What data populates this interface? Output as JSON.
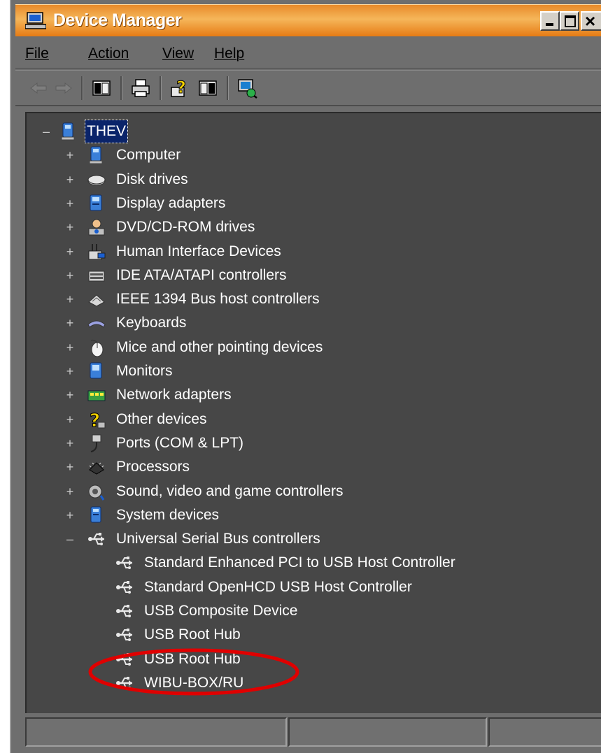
{
  "window": {
    "title": "Device Manager"
  },
  "menu": [
    "File",
    "Action",
    "View",
    "Help"
  ],
  "toolbar_icons": [
    "back-arrow-icon",
    "forward-arrow-icon",
    "properties-pane-icon",
    "print-icon",
    "help-icon",
    "view-pane-icon",
    "scan-hardware-icon"
  ],
  "tree": {
    "root": "THEV",
    "categories": [
      {
        "label": "Computer",
        "icon": "computer-icon",
        "expanded": false
      },
      {
        "label": "Disk drives",
        "icon": "disk-drive-icon",
        "expanded": false
      },
      {
        "label": "Display adapters",
        "icon": "display-adapter-icon",
        "expanded": false
      },
      {
        "label": "DVD/CD-ROM drives",
        "icon": "dvd-drive-icon",
        "expanded": false
      },
      {
        "label": "Human Interface Devices",
        "icon": "hid-icon",
        "expanded": false
      },
      {
        "label": "IDE ATA/ATAPI controllers",
        "icon": "ide-controller-icon",
        "expanded": false
      },
      {
        "label": "IEEE 1394 Bus host controllers",
        "icon": "ieee1394-icon",
        "expanded": false
      },
      {
        "label": "Keyboards",
        "icon": "keyboard-icon",
        "expanded": false
      },
      {
        "label": "Mice and other pointing devices",
        "icon": "mouse-icon",
        "expanded": false
      },
      {
        "label": "Monitors",
        "icon": "monitor-icon",
        "expanded": false
      },
      {
        "label": "Network adapters",
        "icon": "network-adapter-icon",
        "expanded": false
      },
      {
        "label": "Other devices",
        "icon": "question-mark-icon",
        "expanded": false
      },
      {
        "label": "Ports (COM & LPT)",
        "icon": "port-icon",
        "expanded": false
      },
      {
        "label": "Processors",
        "icon": "processor-icon",
        "expanded": false
      },
      {
        "label": "Sound, video and game controllers",
        "icon": "sound-icon",
        "expanded": false
      },
      {
        "label": "System devices",
        "icon": "system-device-icon",
        "expanded": false
      },
      {
        "label": "Universal Serial Bus controllers",
        "icon": "usb-icon",
        "expanded": true
      }
    ],
    "usb_children": [
      "Standard Enhanced PCI to USB Host Controller",
      "Standard OpenHCD USB Host Controller",
      "USB Composite Device",
      "USB Root Hub",
      "USB Root Hub",
      "WIBU-BOX/RU"
    ]
  },
  "expander_symbols": {
    "collapsed": "+",
    "expanded": "–"
  },
  "colors": {
    "titlebar": "#e88a2a",
    "window_bg": "#6e6e6e",
    "tree_bg": "#474747",
    "selection": "#0a246a",
    "annotation": "#e00000"
  }
}
